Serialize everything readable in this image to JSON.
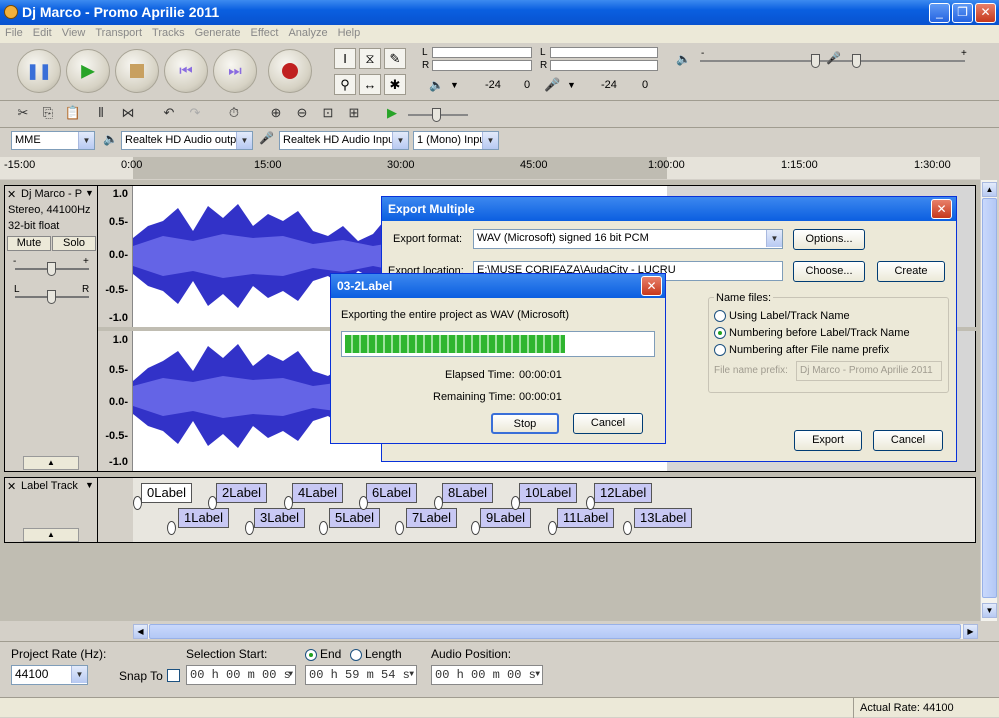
{
  "window": {
    "title": "Dj Marco - Promo Aprilie 2011",
    "min": "_",
    "max": "❐",
    "close": "✕"
  },
  "menu": [
    "File",
    "Edit",
    "View",
    "Transport",
    "Tracks",
    "Generate",
    "Effect",
    "Analyze",
    "Help"
  ],
  "meters": {
    "l": "L",
    "r": "R",
    "scale1": [
      "-24",
      "0"
    ],
    "scale2": [
      "-24",
      "0"
    ],
    "vol_minus": "-",
    "vol_plus": "+"
  },
  "device": {
    "host": "MME",
    "output": "Realtek HD Audio outpu",
    "input": "Realtek HD Audio Input",
    "channels": "1 (Mono) Inpu"
  },
  "ruler": [
    "-15:00",
    "0:00",
    "15:00",
    "30:00",
    "45:00",
    "1:00:00",
    "1:15:00",
    "1:30:00"
  ],
  "track1": {
    "name": "Dj Marco - P",
    "info1": "Stereo, 44100Hz",
    "info2": "32-bit float",
    "mute": "Mute",
    "solo": "Solo",
    "gain_minus": "-",
    "gain_plus": "+",
    "pan_l": "L",
    "pan_r": "R",
    "axis": [
      "1.0",
      "0.5-",
      "0.0-",
      "-0.5-",
      "-1.0"
    ],
    "axis2": [
      "1.0",
      "0.5-",
      "0.0-",
      "-0.5-",
      "-1.0"
    ]
  },
  "labeltrack": {
    "name": "Label Track",
    "labels_top": [
      "0Label",
      "2Label",
      "4Label",
      "6Label",
      "8Label",
      "10Label",
      "12Label"
    ],
    "labels_bottom": [
      "1Label",
      "3Label",
      "5Label",
      "7Label",
      "9Label",
      "11Label",
      "13Label"
    ]
  },
  "export_dialog": {
    "title": "Export Multiple",
    "format_label": "Export format:",
    "format_value": "WAV (Microsoft) signed 16 bit PCM",
    "options": "Options...",
    "location_label": "Export location:",
    "location_value": "E:\\MUSE CORIFAZA\\AudaCity - LUCRU",
    "choose": "Choose...",
    "create": "Create",
    "name_files": "Name files:",
    "opt1": "Using Label/Track Name",
    "opt2": "Numbering before Label/Track Name",
    "opt3": "Numbering after File name prefix",
    "prefix_label": "File name prefix:",
    "prefix_value": "Dj Marco - Promo Aprilie 2011",
    "export": "Export",
    "cancel": "Cancel"
  },
  "progress_dialog": {
    "title": "03-2Label",
    "message": "Exporting the entire project as WAV (Microsoft)",
    "progress": 0.72,
    "elapsed_label": "Elapsed Time:",
    "elapsed": "00:00:01",
    "remaining_label": "Remaining Time:",
    "remaining": "00:00:01",
    "stop": "Stop",
    "cancel": "Cancel"
  },
  "bottom": {
    "project_rate_label": "Project Rate (Hz):",
    "project_rate": "44100",
    "snap_to": "Snap To",
    "selection_start": "Selection Start:",
    "end": "End",
    "length": "Length",
    "audio_position": "Audio Position:",
    "sel_start_value": "00 h 00 m 00 s",
    "end_value": "00 h 59 m 54 s",
    "audio_pos_value": "00 h 00 m 00 s"
  },
  "status": {
    "actual_rate": "Actual Rate: 44100"
  }
}
